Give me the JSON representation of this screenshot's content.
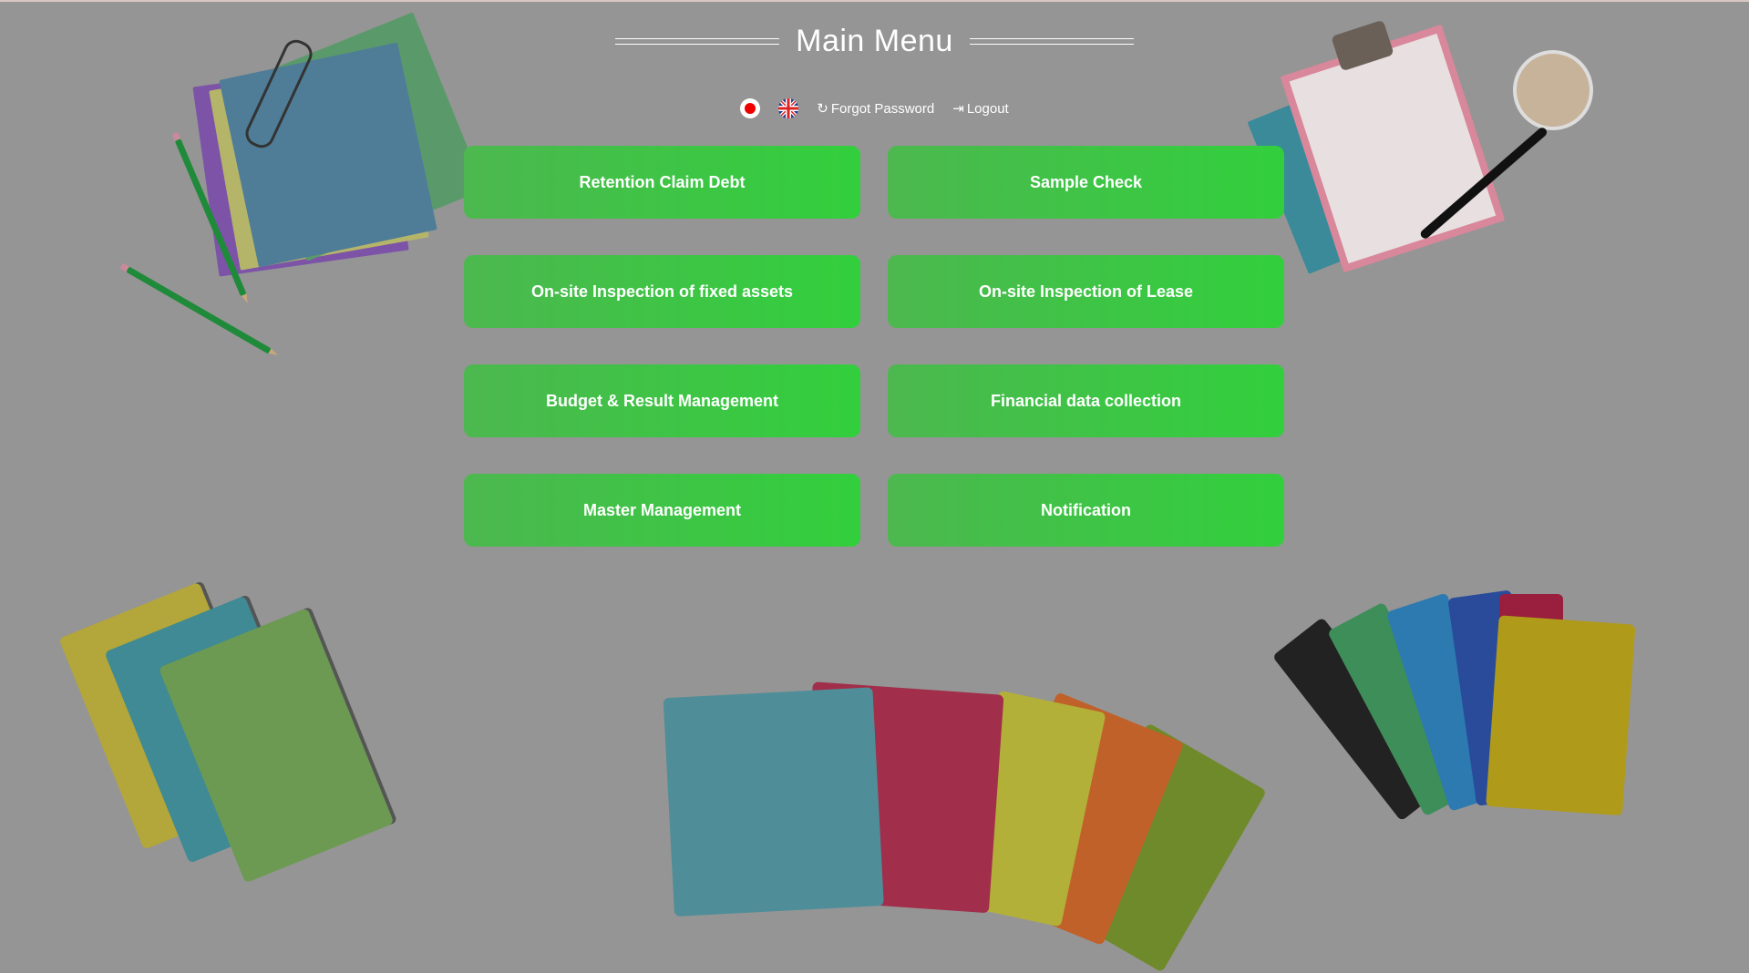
{
  "header": {
    "title": "Main Menu"
  },
  "toolbar": {
    "forgot_password": "Forgot Password",
    "logout": "Logout",
    "languages": [
      "japanese-flag-icon",
      "uk-flag-icon"
    ]
  },
  "menu": {
    "items": [
      {
        "label": "Retention Claim Debt"
      },
      {
        "label": "Sample Check"
      },
      {
        "label": "On-site Inspection of fixed assets"
      },
      {
        "label": "On-site Inspection of Lease"
      },
      {
        "label": "Budget & Result Management"
      },
      {
        "label": "Financial data collection"
      },
      {
        "label": "Master Management"
      },
      {
        "label": "Notification"
      }
    ]
  },
  "colors": {
    "background": "#959595",
    "button_start": "#4cb84f",
    "button_end": "#32cf3d",
    "text": "#ffffff"
  }
}
